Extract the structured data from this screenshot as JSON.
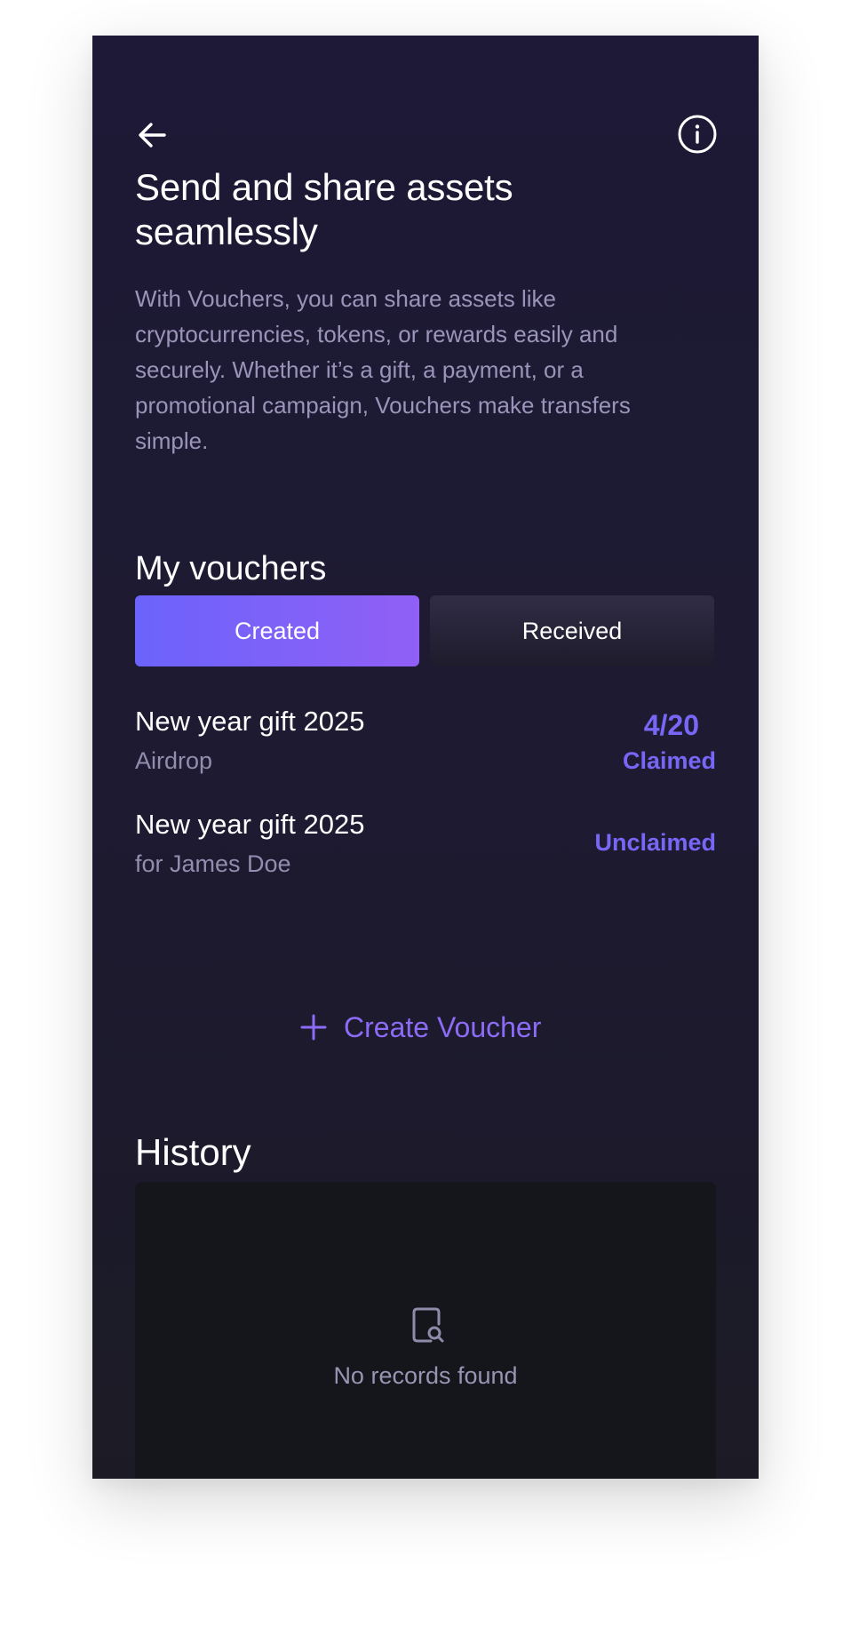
{
  "header": {
    "back_icon": "arrow-left-icon",
    "info_icon": "info-circle-icon"
  },
  "intro": {
    "title": "Send and share assets seamlessly",
    "description": "With Vouchers, you can share assets like cryptocurrencies, tokens, or rewards easily and securely. Whether it’s a gift, a payment, or a promotional campaign, Vouchers make transfers simple."
  },
  "vouchers": {
    "heading": "My vouchers",
    "tabs": [
      {
        "label": "Created",
        "active": true
      },
      {
        "label": "Received",
        "active": false
      }
    ],
    "items": [
      {
        "name": "New year gift 2025",
        "subtitle": "Airdrop",
        "count": "4/20",
        "status": "Claimed"
      },
      {
        "name": "New year gift 2025",
        "subtitle": "for James Doe",
        "count": "",
        "status": "Unclaimed"
      }
    ],
    "create_label": "Create Voucher",
    "create_icon": "plus-icon"
  },
  "history": {
    "heading": "History",
    "empty_icon": "document-search-icon",
    "empty_text": "No records found"
  },
  "colors": {
    "background": "#1d1936",
    "accent": "#7867f6",
    "tab_gradient_start": "#6b63fb",
    "tab_gradient_end": "#9160f6",
    "muted_text": "#9a95b8",
    "card_background": "#14161c"
  }
}
